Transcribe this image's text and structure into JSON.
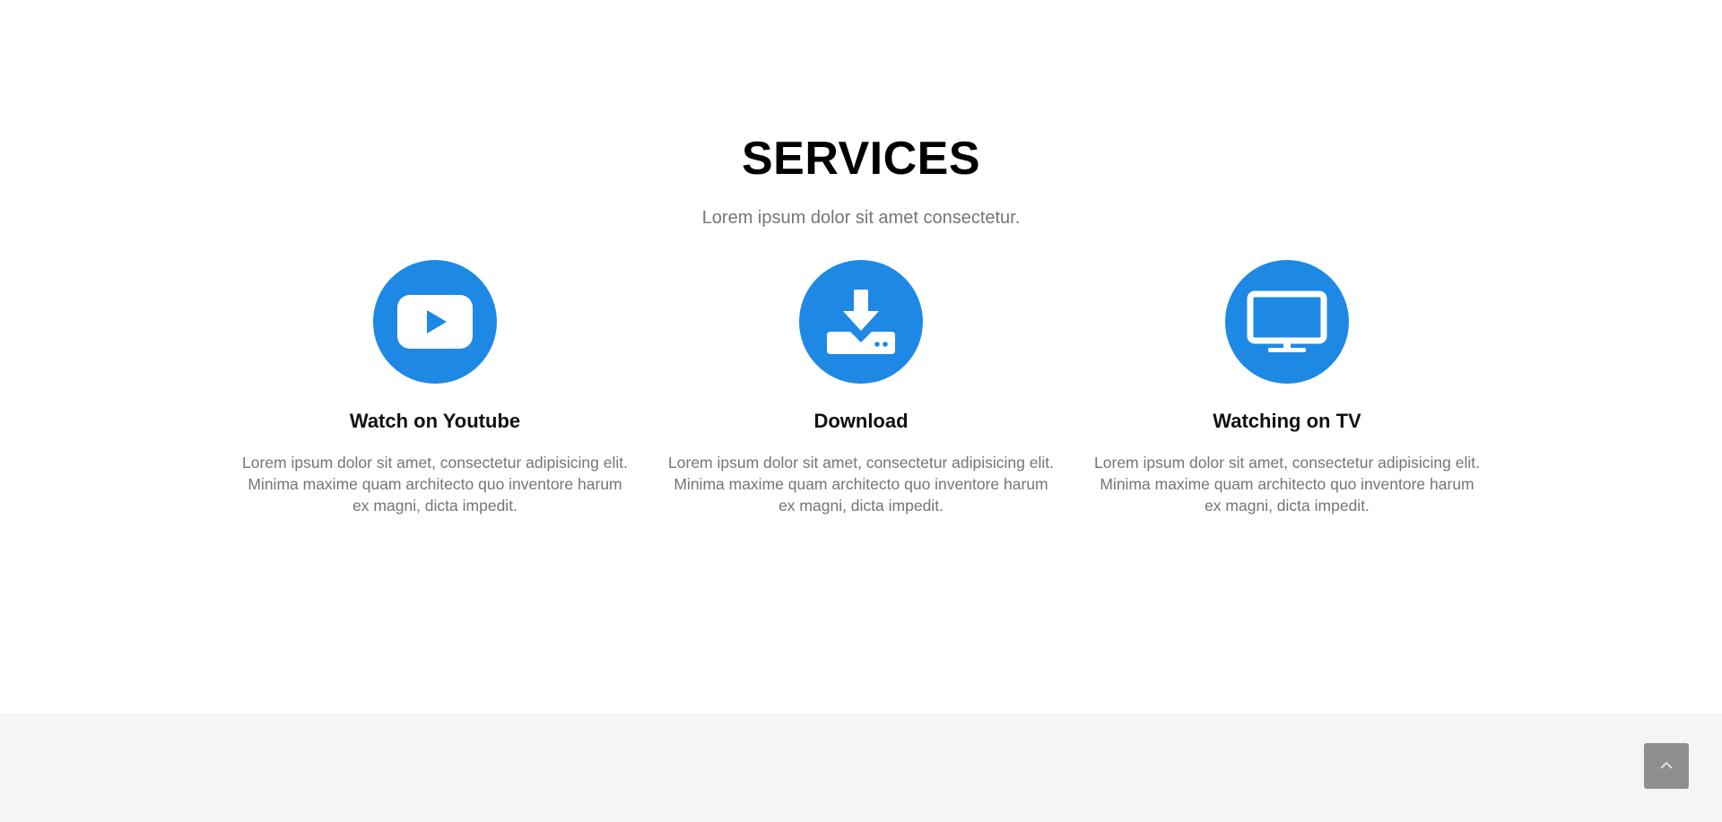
{
  "services": {
    "title": "SERVICES",
    "subtitle": "Lorem ipsum dolor sit amet consectetur.",
    "accent_color": "#1e88e5",
    "items": [
      {
        "icon": "youtube-icon",
        "title": "Watch on Youtube",
        "text": "Lorem ipsum dolor sit amet, consectetur adipisicing elit. Minima maxime quam architecto quo inventore harum ex magni, dicta impedit."
      },
      {
        "icon": "download-icon",
        "title": "Download",
        "text": "Lorem ipsum dolor sit amet, consectetur adipisicing elit. Minima maxime quam architecto quo inventore harum ex magni, dicta impedit."
      },
      {
        "icon": "tv-icon",
        "title": "Watching on TV",
        "text": "Lorem ipsum dolor sit amet, consectetur adipisicing elit. Minima maxime quam architecto quo inventore harum ex magni, dicta impedit."
      }
    ]
  },
  "back_to_top": {
    "icon": "chevron-up-icon",
    "color": "#8f8f8f"
  }
}
